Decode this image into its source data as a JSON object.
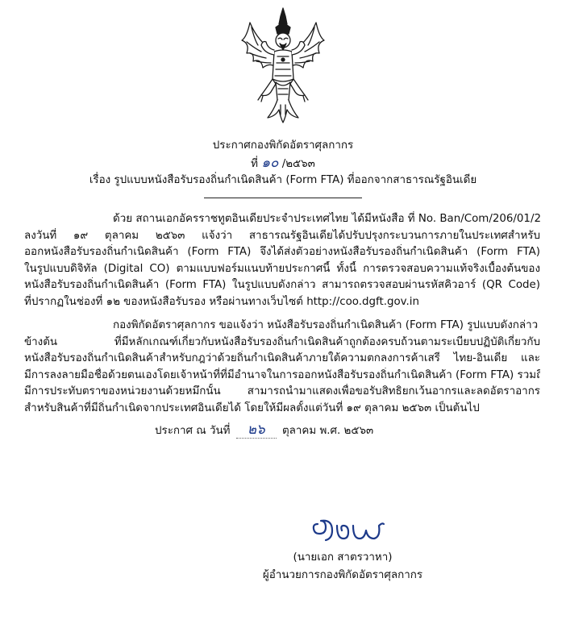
{
  "header": {
    "issuer": "ประกาศกองพิกัดอัตราศุลกากร",
    "number_prefix": "ที่",
    "number_handwritten": "๑๐",
    "number_suffix": "/๒๕๖๓",
    "subject": "เรื่อง  รูปแบบหนังสือรับรองถิ่นกำเนิดสินค้า (Form FTA) ที่ออกจากสาธารณรัฐอินเดีย"
  },
  "emblem": {
    "icon": "garuda-emblem-icon",
    "color": "#1a1a1a"
  },
  "body": {
    "paragraph1": [
      "ด้วย สถานเอกอัครราชทูตอินเดียประจำประเทศไทย ได้มีหนังสือ ที่ No. Ban/Com/206/01/2020",
      "ลงวันที่ ๑๙ ตุลาคม ๒๕๖๓ แจ้งว่า สาธารณรัฐอินเดียได้ปรับปรุงกระบวนการภายในประเทศสำหรับ",
      "ออกหนังสือรับรองถิ่นกำเนิดสินค้า (Form FTA) จึงได้ส่งตัวอย่างหนังสือรับรองถิ่นกำเนิดสินค้า (Form FTA)",
      "ในรูปแบบดิจิทัล (Digital CO) ตามแบบฟอร์มแนบท้ายประกาศนี้ ทั้งนี้ การตรวจสอบความแท้จริงเบื้องต้นของ",
      "หนังสือรับรองถิ่นกำเนิดสินค้า (Form FTA) ในรูปแบบดังกล่าว สามารถตรวจสอบผ่านรหัสคิวอาร์ (QR Code)",
      "ที่ปรากฏในช่องที่ ๑๒ ของหนังสือรับรอง หรือผ่านทางเว็บไซต์ http://coo.dgft.gov.in"
    ],
    "paragraph2": [
      "กองพิกัดอัตราศุลกากร ขอแจ้งว่า หนังสือรับรองถิ่นกำเนิดสินค้า (Form FTA)  รูปแบบดังกล่าว",
      "ข้างต้น  ที่มีหลักเกณฑ์เกี่ยวกับหนังสือรับรองถิ่นกำเนิดสินค้าถูกต้องครบถ้วนตามระเบียบปฏิบัติเกี่ยวกับ",
      "หนังสือรับรองถิ่นกำเนิดสินค้าสำหรับกฎว่าด้วยถิ่นกำเนิดสินค้าภายใต้ความตกลงการค้าเสรี ไทย-อินเดีย และ",
      "มีการลงลายมือชื่อด้วยตนเองโดยเจ้าหน้าที่ที่มีอำนาจในการออกหนังสือรับรองถิ่นกำเนิดสินค้า (Form FTA) รวมถึง",
      "มีการประทับตราของหน่วยงานด้วยหมึกนั้น สามารถนำมาแสดงเพื่อขอรับสิทธิยกเว้นอากรและลดอัตราอากร",
      "สำหรับสินค้าที่มีถิ่นกำเนิดจากประเทศอินเดียได้ โดยให้มีผลตั้งแต่วันที่ ๑๙ ตุลาคม ๒๕๖๓ เป็นต้นไป"
    ]
  },
  "announcement": {
    "prefix": "ประกาศ ณ วันที่",
    "day_handwritten": "๒๖",
    "suffix": "ตุลาคม พ.ศ. ๒๕๖๓"
  },
  "signature": {
    "handwritten_text": "ชวพ",
    "name": "(นายเอก สาตรวาหา)",
    "position": "ผู้อำนวยการกองพิกัดอัตราศุลกากร"
  }
}
